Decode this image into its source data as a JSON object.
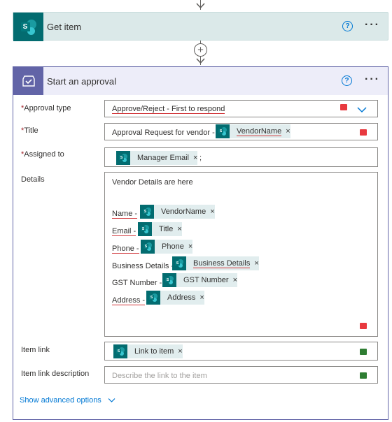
{
  "get_item": {
    "title": "Get item",
    "icon": "sharepoint-icon",
    "help_glyph": "?",
    "menu_glyph": "···"
  },
  "add_step_glyph": "+",
  "approval": {
    "title": "Start an approval",
    "icon": "approvals-icon",
    "help_glyph": "?",
    "menu_glyph": "···",
    "fields": {
      "approval_type": {
        "label": "Approval type",
        "required": "*",
        "value": "Approve/Reject - First to respond"
      },
      "title": {
        "label": "Title",
        "required": "*",
        "text": "Approval Request for vendor -",
        "token": "VendorName"
      },
      "assigned_to": {
        "label": "Assigned to",
        "required": "*",
        "token": "Manager Email",
        "suffix": ";"
      },
      "details": {
        "label": "Details",
        "intro": "Vendor Details are here",
        "lines": [
          {
            "prefix": "Name -",
            "token": "VendorName"
          },
          {
            "prefix": "Email -",
            "token": "Title"
          },
          {
            "prefix": "Phone -",
            "token": "Phone"
          },
          {
            "prefix": "Business Details -",
            "token": "Business Details"
          },
          {
            "prefix": "GST Number -",
            "token": "GST Number"
          },
          {
            "prefix": "Address -",
            "token": "Address"
          }
        ]
      },
      "item_link": {
        "label": "Item link",
        "token": "Link to item"
      },
      "item_link_description": {
        "label": "Item link description",
        "placeholder": "Describe the link to the item"
      }
    },
    "remove_glyph": "×",
    "show_advanced": "Show advanced options"
  },
  "colors": {
    "approval_accent": "#6264a7",
    "sharepoint": "#036c70",
    "error_marker": "#e8393f",
    "ok_marker": "#2e7d32",
    "link": "#0078d4"
  }
}
